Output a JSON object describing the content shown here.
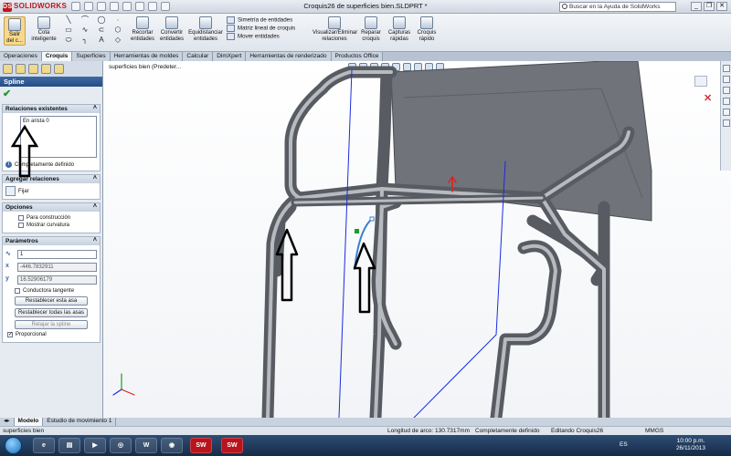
{
  "titlebar": {
    "app": "SOLIDWORKS",
    "doc_title": "Croquis26 de superficies bien.SLDPRT *",
    "help_search_placeholder": "Buscar en la Ayuda de SolidWorks",
    "minimize": "_",
    "restore": "❐",
    "close": "✕"
  },
  "ribbon": {
    "salir": "Salir del c...",
    "cota": "Cota inteligente",
    "recortar": "Recortar entidades",
    "convertir": "Convertir entidades",
    "equidistanciar": "Equidistanciar entidades",
    "simetria": "Simetría de entidades",
    "matriz": "Matriz lineal de croquis",
    "mover": "Mover entidades",
    "visualizar": "Visualizar/Eliminar relaciones",
    "reparar": "Reparar croquis",
    "capturas": "Capturas rápidas",
    "croquis_rapido": "Croquis rápido"
  },
  "tabs": [
    "Operaciones",
    "Croquis",
    "Superficies",
    "Herramientas de moldes",
    "Calcular",
    "DimXpert",
    "Herramientas de renderizado",
    "Productos Office"
  ],
  "active_tab": "Croquis",
  "panel": {
    "title": "Spline",
    "relaciones_existentes": "Relaciones existentes",
    "relation_item": "En arista 0",
    "estado": "Completamente definido",
    "agregar_relaciones": "Agregar relaciones",
    "fijar": "Fijar",
    "opciones": "Opciones",
    "para_construccion": "Para construcción",
    "mostrar_curvatura": "Mostrar curvatura",
    "parametros": "Parámetros",
    "param_count": "1",
    "param_x": "-446.7832911",
    "param_y": "16.52906179",
    "conductora_tangente": "Conductora tangente",
    "restablecer_asa": "Restablecer esta asa",
    "restablecer_todas": "Restablecer todas las asas",
    "relajar": "Relajar la spline",
    "proporcional": "Proporcional"
  },
  "viewport": {
    "tree_label": "superficies bien  (Predeter..."
  },
  "bottom_tabs": [
    "Modelo",
    "Estudio de movimiento 1"
  ],
  "status": {
    "part": "superficies bien",
    "longitud": "Longitud de arco: 130.7317mm",
    "definido": "Completamente definido",
    "editando": "Editando Croquis26",
    "units": "MMGS"
  },
  "taskbar": {
    "lang": "ES",
    "time": "10:00 p.m.",
    "date": "26/11/2013",
    "sw1": "SW",
    "sw2": "SW"
  },
  "colors": {
    "tube": "#6b6e75",
    "tube_highlight": "#b9bcc2",
    "sketch_line": "#1a2de0",
    "spline": "#3a7fd0",
    "arrow": "#000000"
  }
}
